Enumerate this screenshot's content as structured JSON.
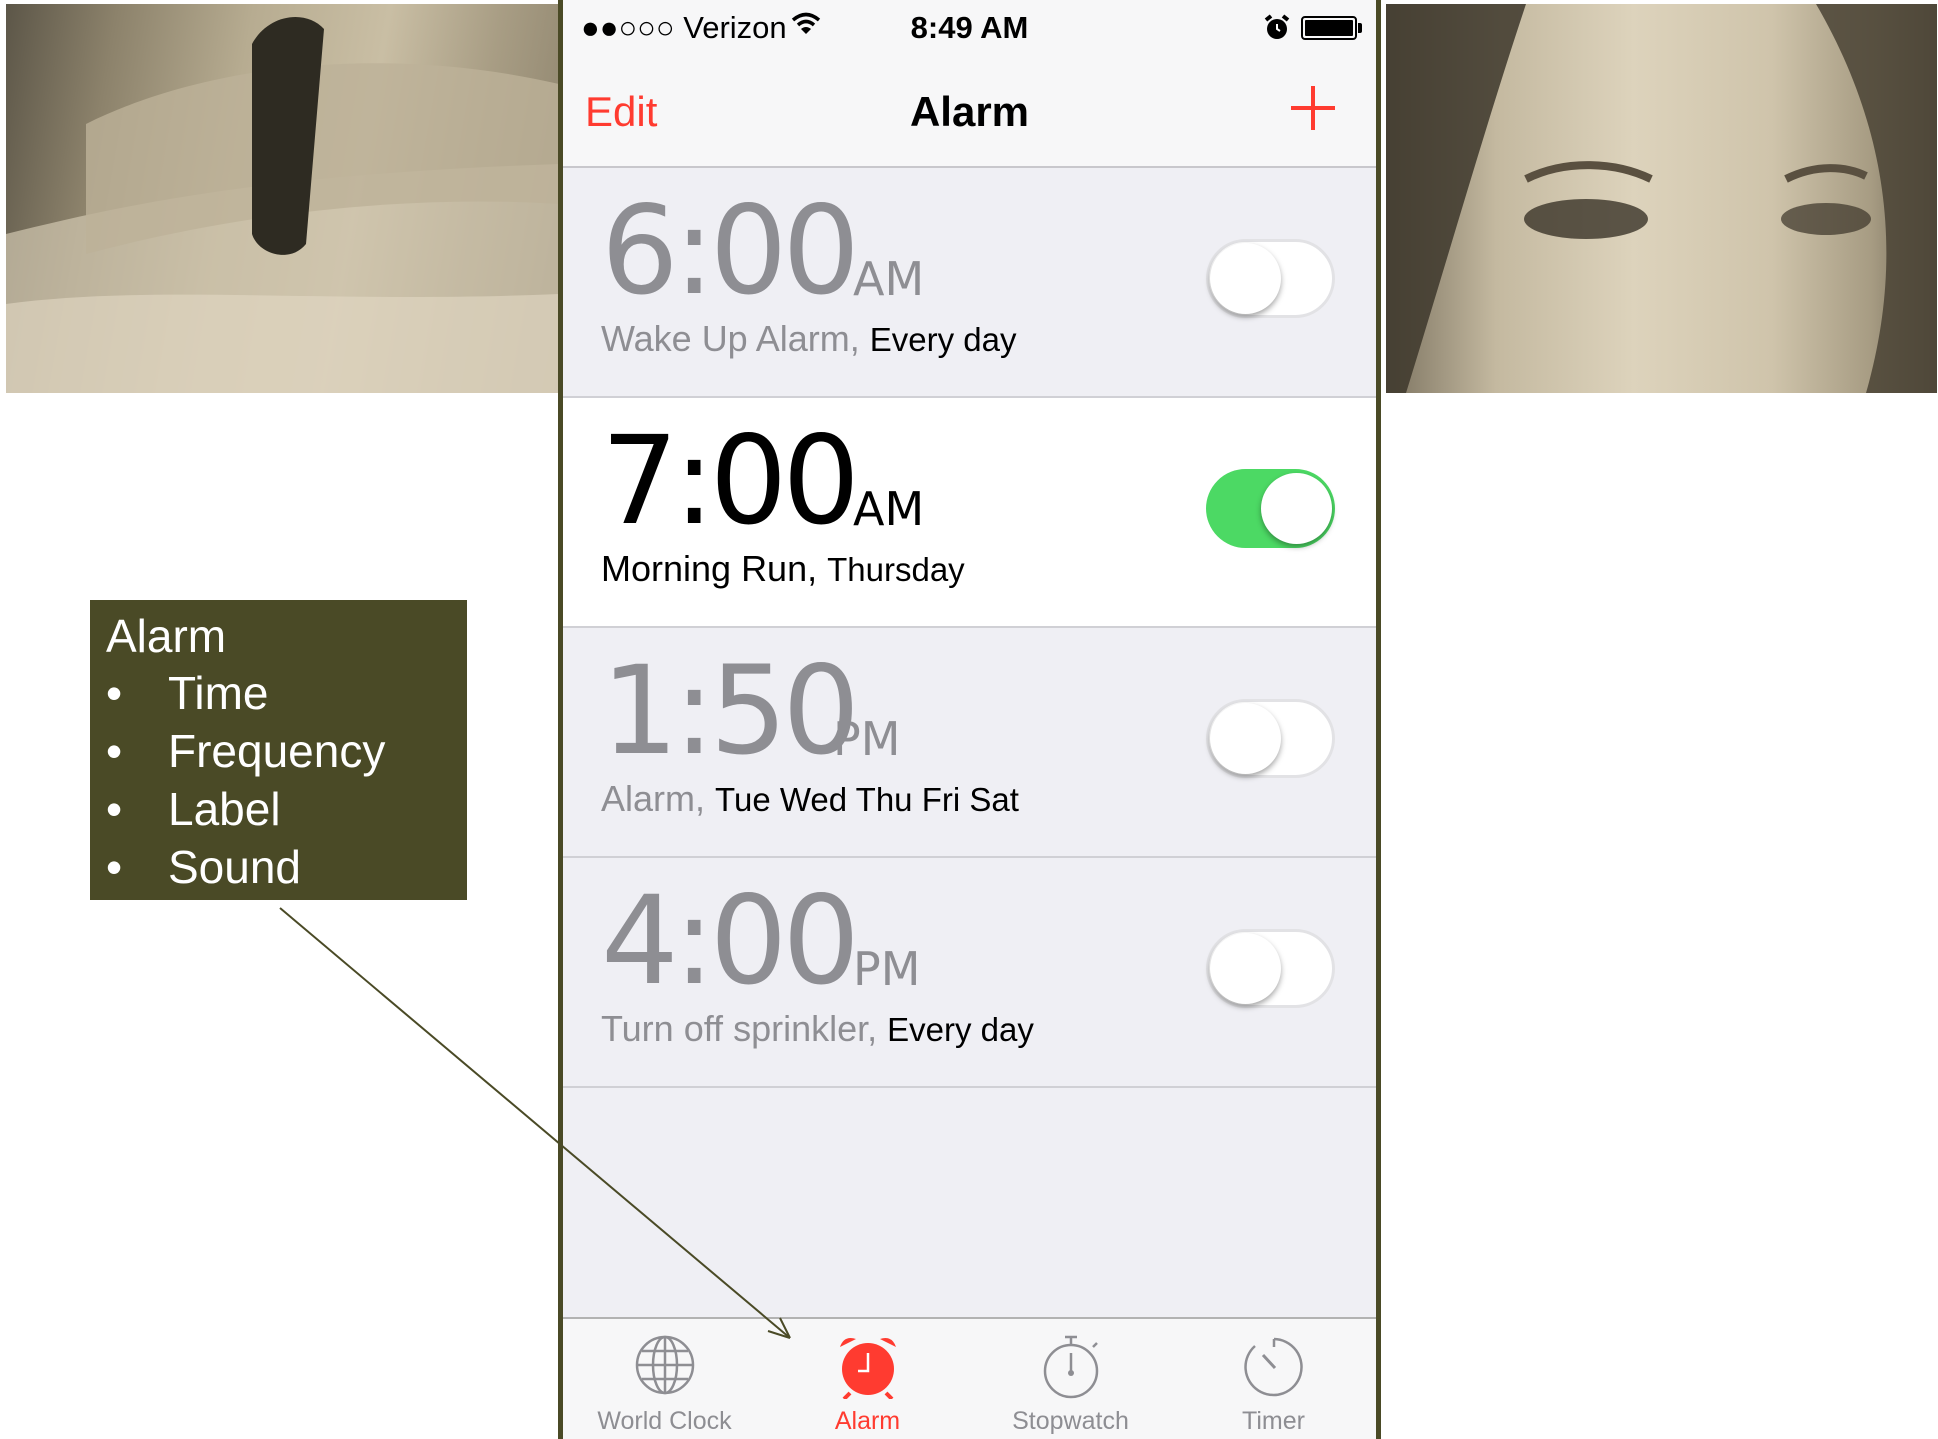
{
  "status_bar": {
    "carrier": "●●○○○ Verizon",
    "time": "8:49 AM",
    "battery_level": 1.0
  },
  "nav": {
    "edit_label": "Edit",
    "title": "Alarm",
    "add_icon": "plus-icon"
  },
  "alarms": [
    {
      "time": "6:00",
      "ampm": "AM",
      "label": "Wake Up Alarm,",
      "frequency": "Every day",
      "enabled": false
    },
    {
      "time": "7:00",
      "ampm": "AM",
      "label": "Morning Run,",
      "frequency": "Thursday",
      "enabled": true
    },
    {
      "time": "1:50",
      "ampm": "PM",
      "label": "Alarm,",
      "frequency": "Tue Wed Thu Fri Sat",
      "enabled": false
    },
    {
      "time": "4:00",
      "ampm": "PM",
      "label": "Turn off sprinkler,",
      "frequency": "Every day",
      "enabled": false
    }
  ],
  "tabs": [
    {
      "label": "World Clock",
      "icon": "globe-icon",
      "active": false
    },
    {
      "label": "Alarm",
      "icon": "alarm-clock-icon",
      "active": true
    },
    {
      "label": "Stopwatch",
      "icon": "stopwatch-icon",
      "active": false
    },
    {
      "label": "Timer",
      "icon": "timer-icon",
      "active": false
    }
  ],
  "callout": {
    "title": "Alarm",
    "items": [
      "Time",
      "Frequency",
      "Label",
      "Sound"
    ]
  },
  "colors": {
    "accent": "#ff3b30",
    "toggle_on": "#4cd964",
    "callout_bg": "#4a4a26",
    "frame": "#4a4a26"
  }
}
